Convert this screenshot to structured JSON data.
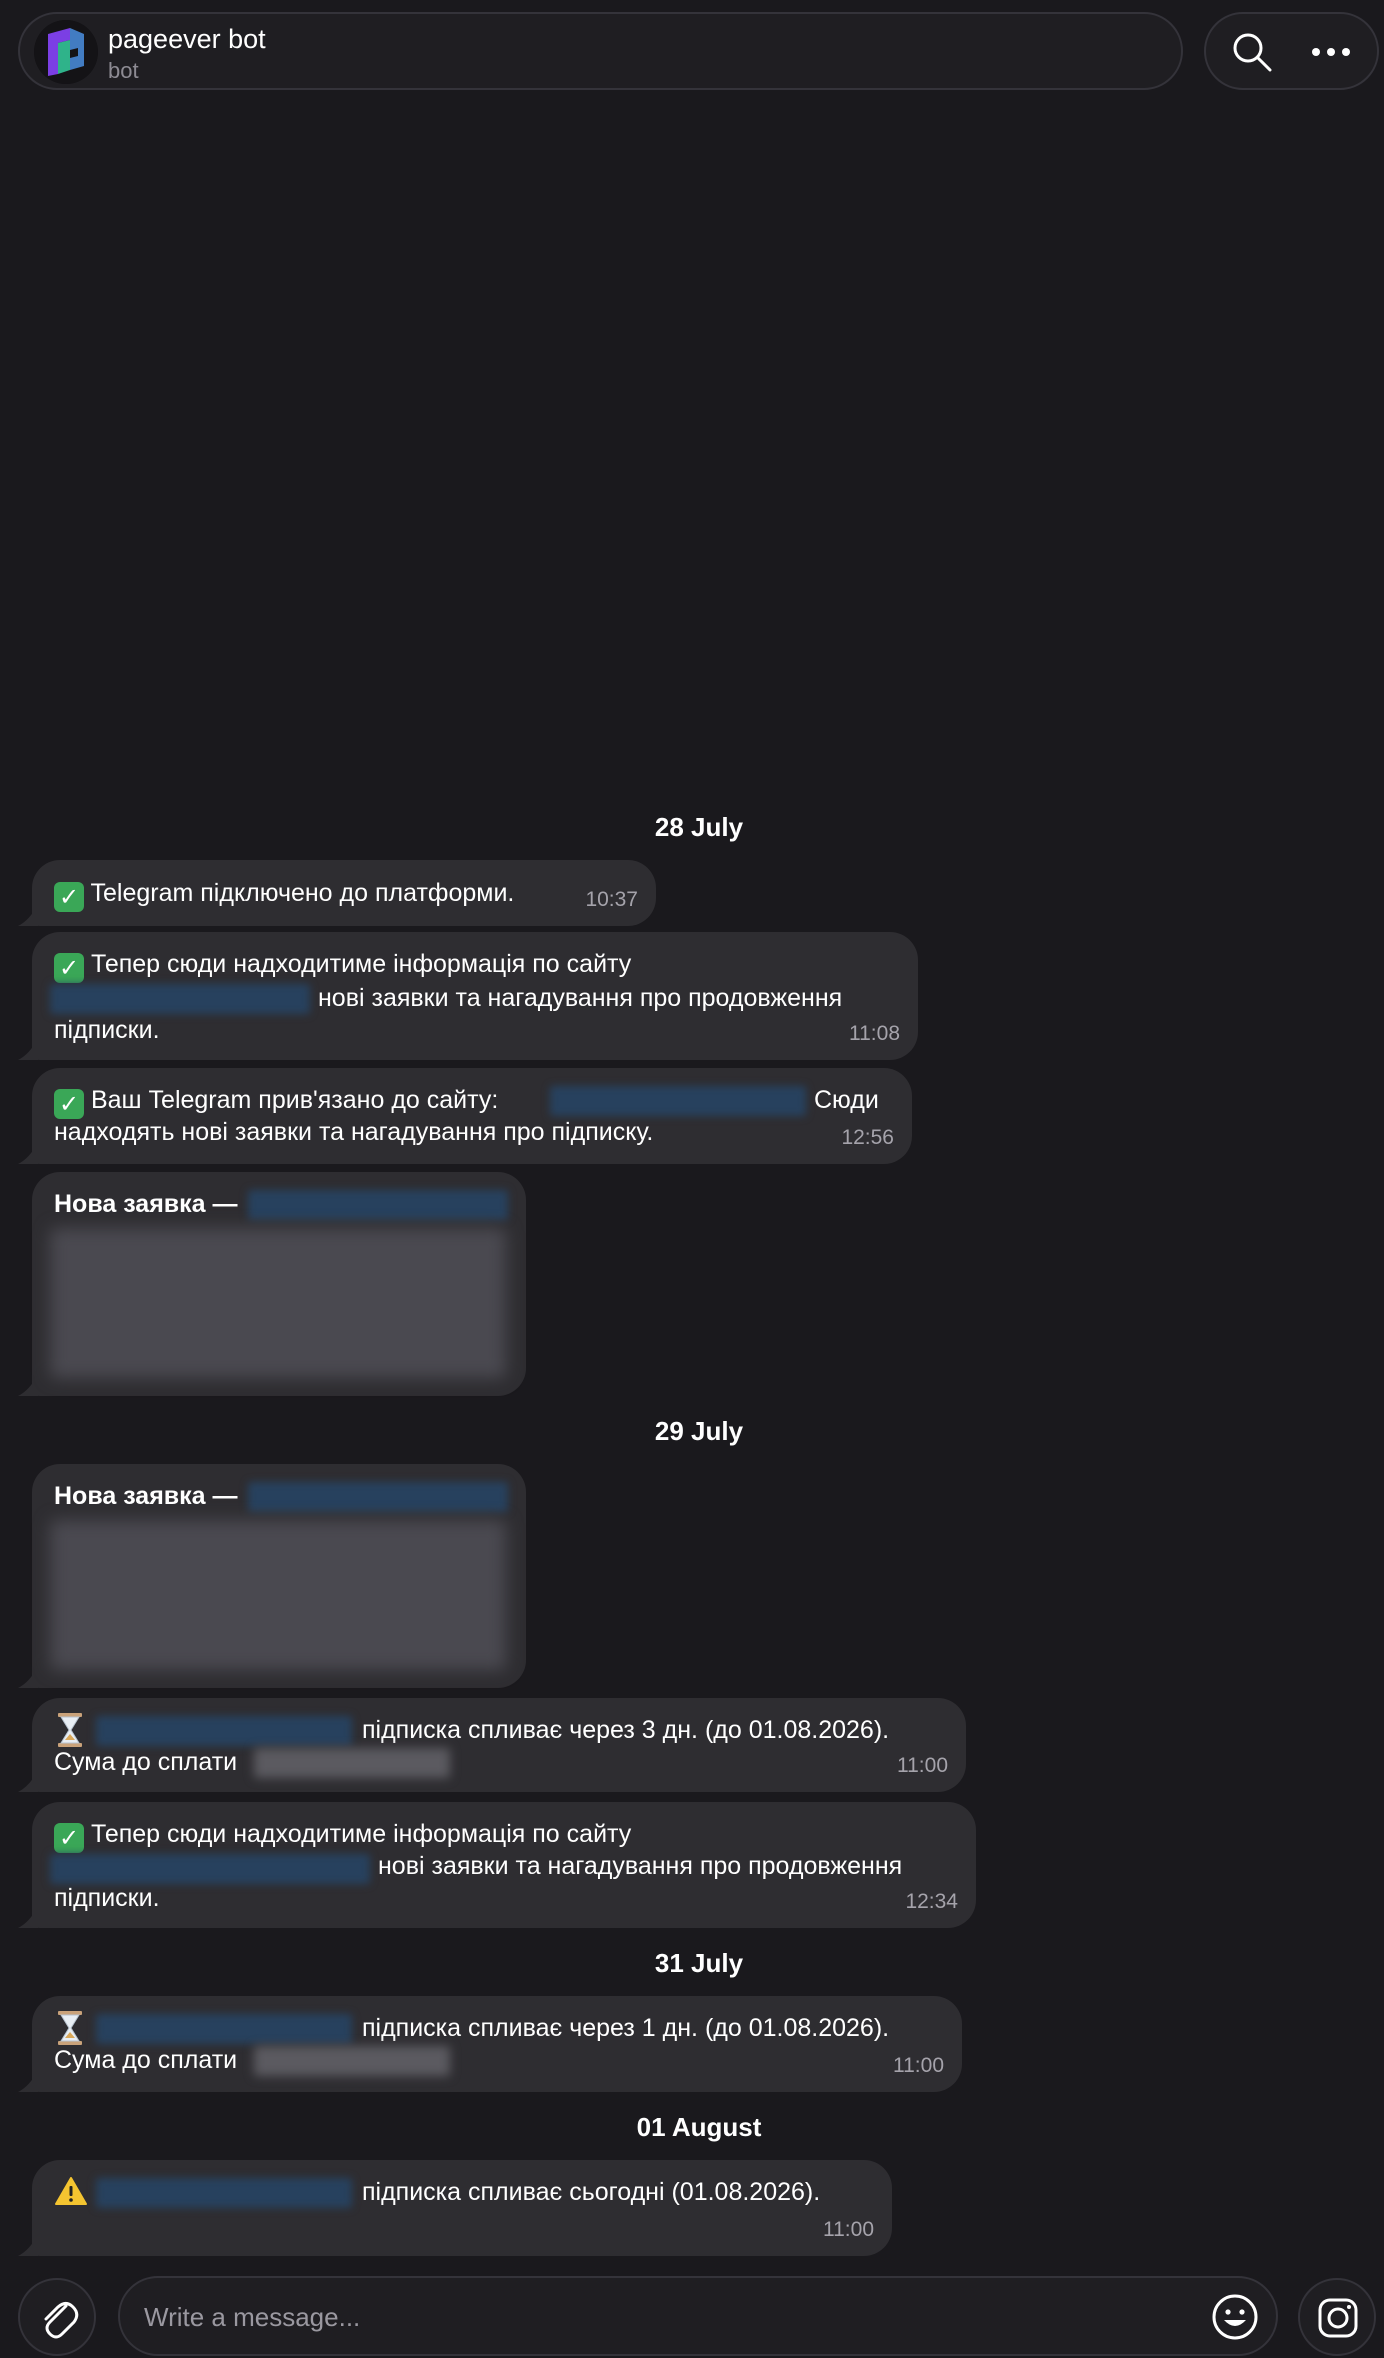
{
  "header": {
    "title": "pageever bot",
    "subtitle": "bot"
  },
  "dates": [
    "28 July",
    "29 July",
    "31 July",
    "01 August"
  ],
  "messages": [
    {
      "line1": "Telegram підключено до платформи.",
      "time": "10:37"
    },
    {
      "line1": "Тепер сюди надходитиме інформація по сайту",
      "line2": "нові заявки та нагадування про продовження",
      "line3": "підписки.",
      "time": "11:08"
    },
    {
      "line1": "Ваш Telegram прив'язано до сайту:",
      "line1b": "Сюди",
      "line2": "надходять нові заявки та нагадування про підписку.",
      "time": "12:56"
    },
    {
      "title": "Нова заявка —"
    },
    {
      "title": "Нова заявка —"
    },
    {
      "line1": "підписка спливає через 3 дн. (до 01.08.2026).",
      "line2": "Сума до сплати",
      "time": "11:00"
    },
    {
      "line1": "Тепер сюди надходитиме інформація по сайту",
      "line2": "нові заявки та нагадування про продовження",
      "line3": "підписки.",
      "time": "12:34"
    },
    {
      "line1": "підписка спливає через 1 дн. (до 01.08.2026).",
      "line2": "Сума до сплати",
      "time": "11:00"
    },
    {
      "line1": "підписка спливає сьогодні (01.08.2026).",
      "time": "11:00"
    }
  ],
  "composer": {
    "placeholder": "Write a message..."
  },
  "icons": {
    "attach": "paperclip-icon",
    "emoji": "smiley-icon",
    "sticker": "sticker-icon",
    "search": "search-icon",
    "more": "more-dots-icon",
    "check": "check-mark-emoji",
    "hourglass": "hourglass-emoji",
    "warning": "warning-emoji"
  },
  "colors": {
    "background": "#1a191d",
    "bubble": "#2e2d31",
    "check": "#3aa757",
    "warning": "#f4c430"
  }
}
